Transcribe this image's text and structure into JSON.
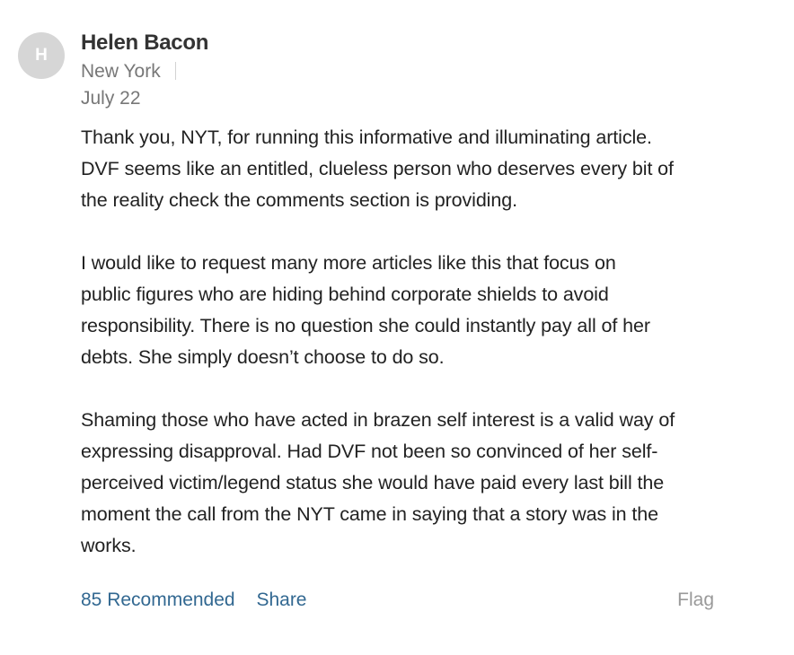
{
  "comment": {
    "avatar_initial": "H",
    "author": "Helen Bacon",
    "location": "New York",
    "date": "July 22",
    "paragraphs": [
      "Thank you, NYT, for running this informative and illuminating article.\nDVF seems like an entitled, clueless person who deserves every bit of\nthe reality check the comments section is providing.",
      "I would like to request many more articles like this that focus on\npublic figures who are hiding behind corporate shields to avoid\nresponsibility. There is no question she could instantly pay all of her\ndebts. She simply doesn’t choose to do so.",
      "Shaming those who have acted in brazen self interest is a valid way of\nexpressing disapproval. Had DVF not been so convinced of her self-\nperceived victim/legend status she would have paid every last bill the\nmoment the call from the NYT came in saying that a story was in the\nworks."
    ],
    "actions": {
      "recommended": "85 Recommended",
      "share": "Share",
      "flag": "Flag"
    }
  },
  "colors": {
    "link": "#326891",
    "muted": "#777777",
    "avatar_bg": "#d6d6d6"
  }
}
